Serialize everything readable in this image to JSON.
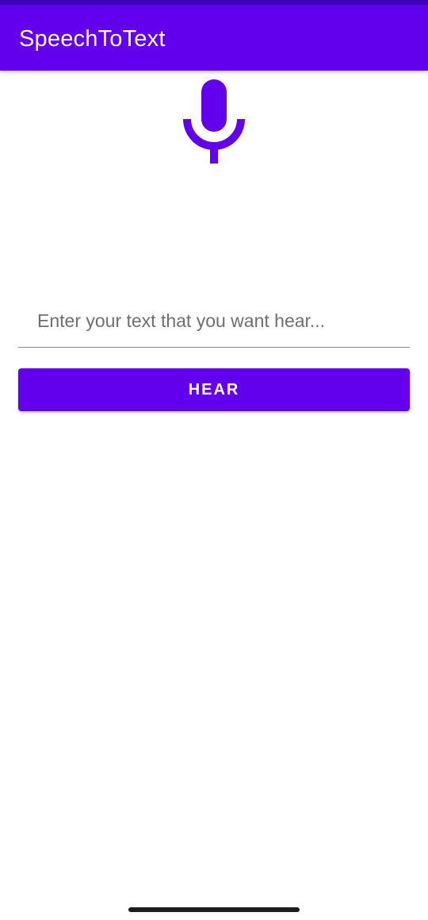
{
  "app": {
    "title": "SpeechToText",
    "accent_color": "#6200ee",
    "status_bar_color": "#3d00b8"
  },
  "mic": {
    "icon": "microphone-icon"
  },
  "input": {
    "value": "",
    "placeholder": "Enter your text that you want hear..."
  },
  "actions": {
    "hear_label": "HEAR"
  }
}
